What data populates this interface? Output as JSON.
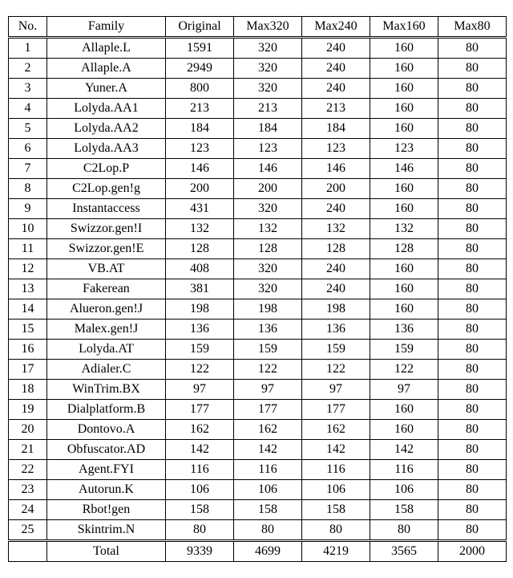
{
  "chart_data": {
    "type": "table",
    "columns": [
      "No.",
      "Family",
      "Original",
      "Max320",
      "Max240",
      "Max160",
      "Max80"
    ],
    "rows": [
      [
        1,
        "Allaple.L",
        1591,
        320,
        240,
        160,
        80
      ],
      [
        2,
        "Allaple.A",
        2949,
        320,
        240,
        160,
        80
      ],
      [
        3,
        "Yuner.A",
        800,
        320,
        240,
        160,
        80
      ],
      [
        4,
        "Lolyda.AA1",
        213,
        213,
        213,
        160,
        80
      ],
      [
        5,
        "Lolyda.AA2",
        184,
        184,
        184,
        160,
        80
      ],
      [
        6,
        "Lolyda.AA3",
        123,
        123,
        123,
        123,
        80
      ],
      [
        7,
        "C2Lop.P",
        146,
        146,
        146,
        146,
        80
      ],
      [
        8,
        "C2Lop.gen!g",
        200,
        200,
        200,
        160,
        80
      ],
      [
        9,
        "Instantaccess",
        431,
        320,
        240,
        160,
        80
      ],
      [
        10,
        "Swizzor.gen!I",
        132,
        132,
        132,
        132,
        80
      ],
      [
        11,
        "Swizzor.gen!E",
        128,
        128,
        128,
        128,
        80
      ],
      [
        12,
        "VB.AT",
        408,
        320,
        240,
        160,
        80
      ],
      [
        13,
        "Fakerean",
        381,
        320,
        240,
        160,
        80
      ],
      [
        14,
        "Alueron.gen!J",
        198,
        198,
        198,
        160,
        80
      ],
      [
        15,
        "Malex.gen!J",
        136,
        136,
        136,
        136,
        80
      ],
      [
        16,
        "Lolyda.AT",
        159,
        159,
        159,
        159,
        80
      ],
      [
        17,
        "Adialer.C",
        122,
        122,
        122,
        122,
        80
      ],
      [
        18,
        "WinTrim.BX",
        97,
        97,
        97,
        97,
        80
      ],
      [
        19,
        "Dialplatform.B",
        177,
        177,
        177,
        160,
        80
      ],
      [
        20,
        "Dontovo.A",
        162,
        162,
        162,
        160,
        80
      ],
      [
        21,
        "Obfuscator.AD",
        142,
        142,
        142,
        142,
        80
      ],
      [
        22,
        "Agent.FYI",
        116,
        116,
        116,
        116,
        80
      ],
      [
        23,
        "Autorun.K",
        106,
        106,
        106,
        106,
        80
      ],
      [
        24,
        "Rbot!gen",
        158,
        158,
        158,
        158,
        80
      ],
      [
        25,
        "Skintrim.N",
        80,
        80,
        80,
        80,
        80
      ]
    ],
    "total_row": [
      "",
      "Total",
      9339,
      4699,
      4219,
      3565,
      2000
    ]
  }
}
